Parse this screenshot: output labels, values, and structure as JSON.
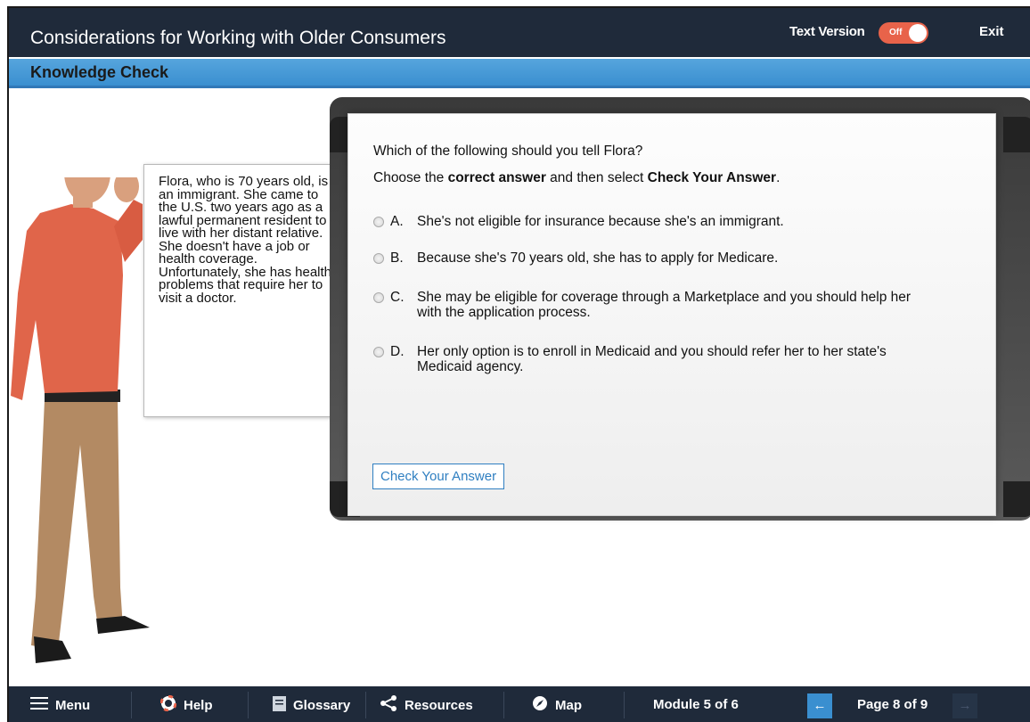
{
  "header": {
    "title": "Considerations for Working with Older Consumers",
    "text_version_label": "Text Version",
    "toggle_state": "Off",
    "exit_label": "Exit"
  },
  "section": {
    "title": "Knowledge Check"
  },
  "scenario": {
    "text": "Flora, who is 70 years old, is an immigrant. She came to the U.S. two years ago as a lawful permanent resident to live with her distant relative. She doesn't have a job or health coverage. Unfortunately, she has health problems that require her to visit a doctor."
  },
  "quiz": {
    "question": "Which of the following should you tell Flora?",
    "instruction_pre": "Choose the ",
    "instruction_bold1": "correct answer",
    "instruction_mid": " and then select ",
    "instruction_bold2": "Check Your Answer",
    "instruction_post": ".",
    "options": [
      {
        "letter": "A.",
        "text": "She's not eligible for insurance because she's an immigrant."
      },
      {
        "letter": "B.",
        "text": "Because she's 70 years old, she has to apply for Medicare."
      },
      {
        "letter": "C.",
        "text": "She may be eligible for coverage through a Marketplace and you should help her with the application process."
      },
      {
        "letter": "D.",
        "text": "Her only option is to enroll in Medicaid and you should refer her to her state's Medicaid agency."
      }
    ],
    "check_button": "Check Your Answer"
  },
  "footer": {
    "menu": "Menu",
    "help": "Help",
    "glossary": "Glossary",
    "resources": "Resources",
    "map": "Map",
    "module": "Module 5 of 6",
    "page": "Page 8 of 9",
    "prev_icon": "←",
    "next_icon": "→"
  },
  "colors": {
    "header_bg": "#1f2a3a",
    "section_bar": "#4a9ad8",
    "toggle_accent": "#e8634a",
    "link_blue": "#2f7fc1"
  }
}
